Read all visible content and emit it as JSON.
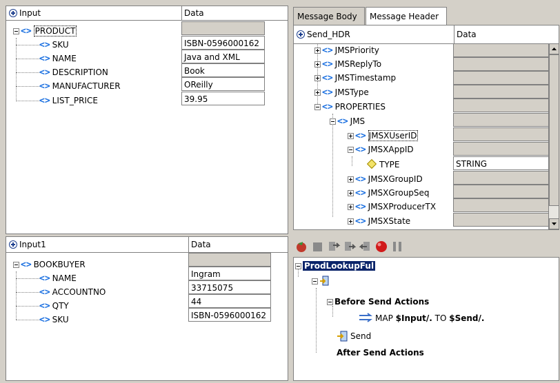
{
  "input_panel": {
    "header": {
      "name": "Input",
      "data": "Data"
    },
    "root": "PRODUCT",
    "fields": [
      {
        "label": "SKU",
        "value": "ISBN-0596000162"
      },
      {
        "label": "NAME",
        "value": "Java and XML"
      },
      {
        "label": "DESCRIPTION",
        "value": "Book"
      },
      {
        "label": "MANUFACTURER",
        "value": "OReilly"
      },
      {
        "label": "LIST_PRICE",
        "value": "39.95"
      }
    ]
  },
  "input1_panel": {
    "header": {
      "name": "Input1",
      "data": "Data"
    },
    "root": "BOOKBUYER",
    "fields": [
      {
        "label": "NAME",
        "value": "Ingram"
      },
      {
        "label": "ACCOUNTNO",
        "value": "33715075"
      },
      {
        "label": "QTY",
        "value": "44"
      },
      {
        "label": "SKU",
        "value": "ISBN-0596000162"
      }
    ]
  },
  "message_panel": {
    "tabs": [
      {
        "label": "Message Body"
      },
      {
        "label": "Message Header"
      }
    ],
    "active_tab": "Message Header",
    "header": {
      "name": "Send_HDR",
      "data": "Data"
    },
    "items": [
      {
        "label": "JMSPriority",
        "value": ""
      },
      {
        "label": "JMSReplyTo",
        "value": ""
      },
      {
        "label": "JMSTimestamp",
        "value": ""
      },
      {
        "label": "JMSType",
        "value": ""
      },
      {
        "label": "PROPERTIES",
        "value": ""
      },
      {
        "label": "JMS",
        "value": ""
      },
      {
        "label": "JMSXUserID",
        "value": ""
      },
      {
        "label": "JMSXAppID",
        "value": ""
      },
      {
        "label": "TYPE",
        "value": "STRING"
      },
      {
        "label": "JMSXGroupID",
        "value": ""
      },
      {
        "label": "JMSXGroupSeq",
        "value": ""
      },
      {
        "label": "JMSXProducerTX",
        "value": ""
      },
      {
        "label": "JMSXState",
        "value": ""
      }
    ]
  },
  "rules_panel": {
    "root": "ProdLookupFul",
    "before_label": "Before Send Actions",
    "map_prefix": "MAP",
    "map_source": "$Input/.",
    "map_to": "TO",
    "map_target": "$Send/.",
    "send_label": "Send",
    "after_label": "After Send Actions"
  },
  "colors": {
    "tag": "#1a6fe0",
    "tag_rules": "#2f9a2f",
    "selection": "#0a246a"
  }
}
